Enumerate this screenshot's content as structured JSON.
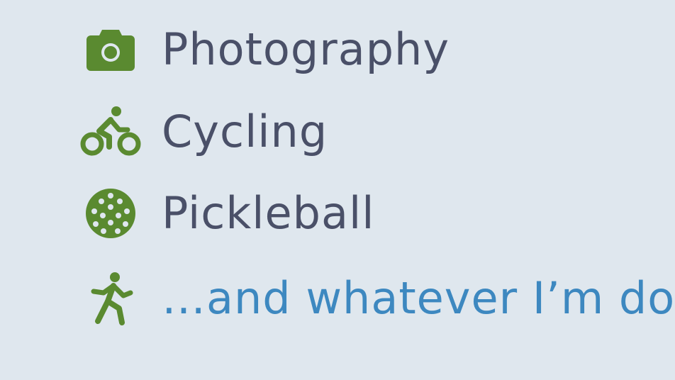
{
  "colors": {
    "background": "#dfe7ee",
    "text": "#4a5068",
    "link": "#3d88c0",
    "icon": "#5a8a30"
  },
  "hobbies": [
    {
      "icon": "camera-icon",
      "label": "Photography"
    },
    {
      "icon": "cyclist-icon",
      "label": "Cycling"
    },
    {
      "icon": "pickleball-icon",
      "label": "Pickleball"
    },
    {
      "icon": "running-person-icon",
      "label": "…and whatever I’m doing"
    }
  ]
}
